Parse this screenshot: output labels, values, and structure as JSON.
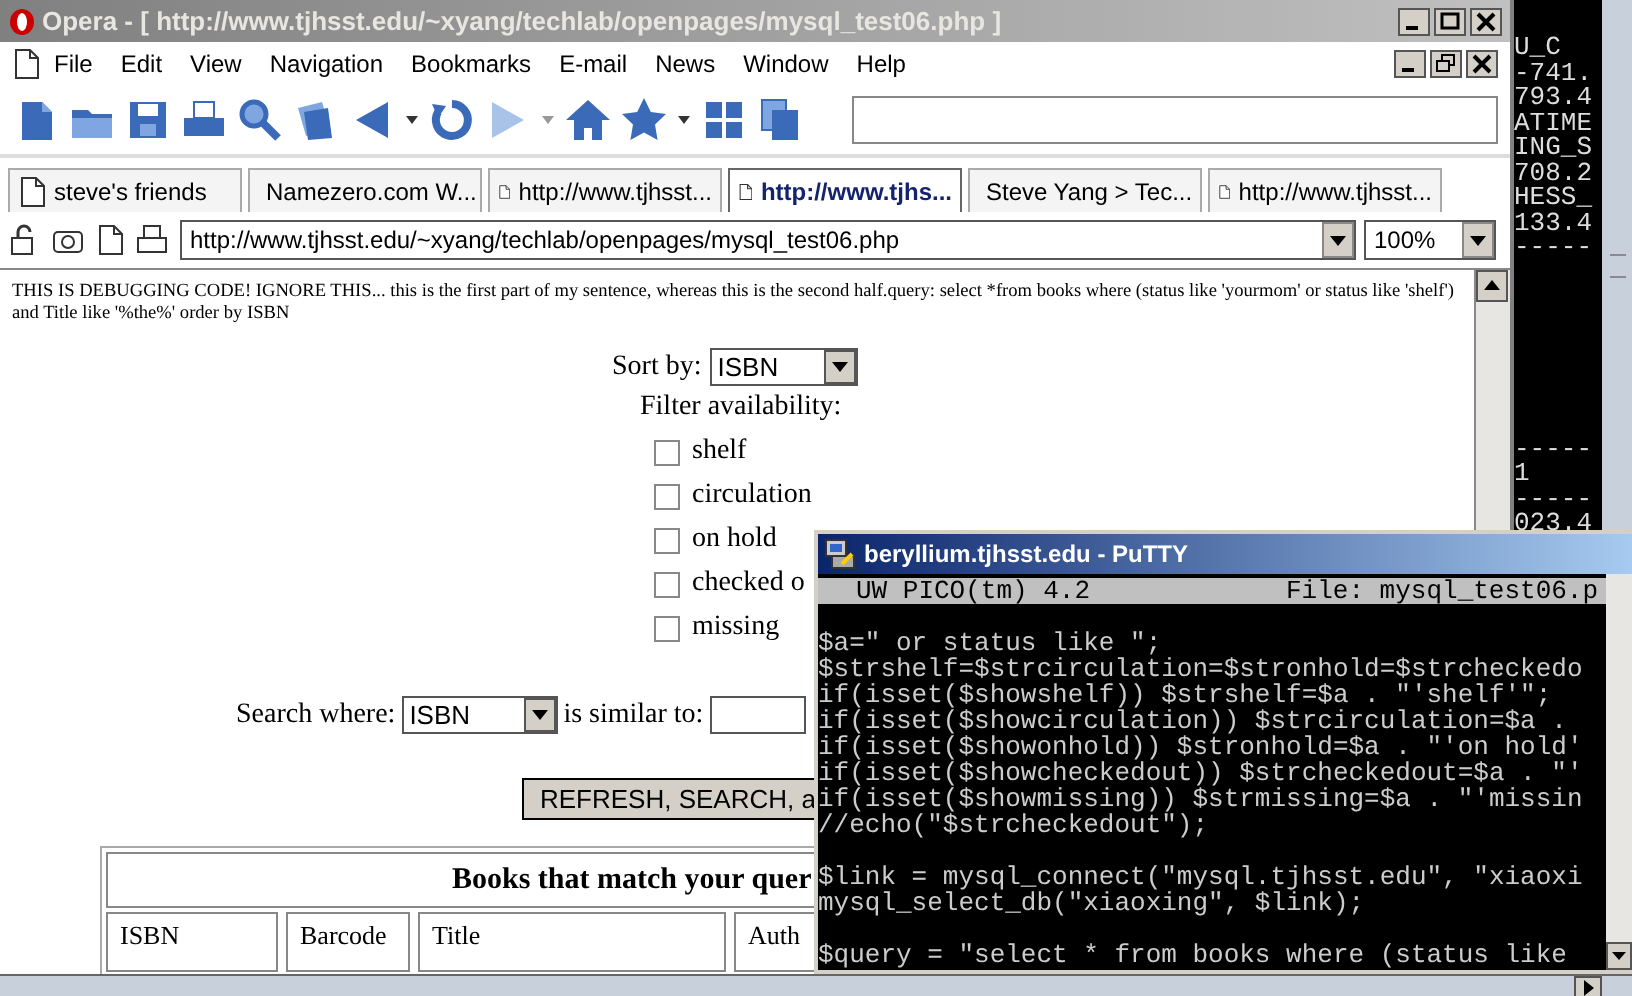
{
  "opera_window": {
    "title": "Opera - [ http://www.tjhsst.edu/~xyang/techlab/openpages/mysql_test06.php ]",
    "menu": [
      "File",
      "Edit",
      "View",
      "Navigation",
      "Bookmarks",
      "E-mail",
      "News",
      "Window",
      "Help"
    ],
    "tabs": [
      {
        "label": "steve's friends",
        "selected": false
      },
      {
        "label": "Namezero.com W...",
        "selected": false
      },
      {
        "label": "http://www.tjhsst...",
        "selected": false
      },
      {
        "label": "http://www.tjhs...",
        "selected": true
      },
      {
        "label": "Steve Yang > Tec...",
        "selected": false
      },
      {
        "label": "http://www.tjhsst...",
        "selected": false
      }
    ],
    "address": {
      "value": "http://www.tjhsst.edu/~xyang/techlab/openpages/mysql_test06.php"
    },
    "zoom": {
      "value": "100%"
    },
    "page": {
      "debug_text": "THIS IS DEBUGGING CODE! IGNORE THIS... this is the first part of my sentence, whereas this is the second half.query: select *from books where (status like 'yourmom' or status like 'shelf') and Title like '%the%' order by ISBN",
      "sort_by": {
        "label": "Sort by:",
        "value": "ISBN"
      },
      "filter_label": "Filter availability:",
      "filters": [
        {
          "label": "shelf",
          "checked": false
        },
        {
          "label": "circulation",
          "checked": false
        },
        {
          "label": "on hold",
          "checked": false
        },
        {
          "label": "checked o",
          "checked": false
        },
        {
          "label": "missing",
          "checked": false
        }
      ],
      "search_where": {
        "label": "Search where:",
        "value": "ISBN"
      },
      "similar_label": "is similar to:",
      "submit_button": "REFRESH, SEARCH, a",
      "results_table": {
        "title": "Books that match your quer",
        "columns": [
          "ISBN",
          "Barcode",
          "Title",
          "Auth"
        ]
      }
    }
  },
  "terminal_background": {
    "upper_lines": [
      "U_C",
      "-741.",
      "793.4",
      "ATIME",
      "ING_S",
      "708.2",
      "HESS_",
      "133.4",
      "-----"
    ],
    "lower_lines": [
      "-----",
      "1",
      "-----",
      "023.4"
    ]
  },
  "putty_window": {
    "title": "beryllium.tjhsst.edu - PuTTY",
    "editor_header": {
      "program": "UW PICO(tm) 4.2",
      "file": "File: mysql_test06.p"
    },
    "code_blocks": [
      [
        "$a=\" or status like \";",
        "$strshelf=$strcirculation=$stronhold=$strcheckedo",
        "if(isset($showshelf)) $strshelf=$a . \"'shelf'\";",
        "if(isset($showcirculation)) $strcirculation=$a .",
        "if(isset($showonhold)) $stronhold=$a . \"'on hold'",
        "if(isset($showcheckedout)) $strcheckedout=$a . \"'",
        "if(isset($showmissing)) $strmissing=$a . \"'missin",
        "//echo(\"$strcheckedout\");"
      ],
      [
        "$link = mysql_connect(\"mysql.tjhsst.edu\", \"xiaoxi",
        "mysql_select_db(\"xiaoxing\", $link);"
      ],
      [
        "$query = \"select * from books where (status like"
      ]
    ]
  }
}
